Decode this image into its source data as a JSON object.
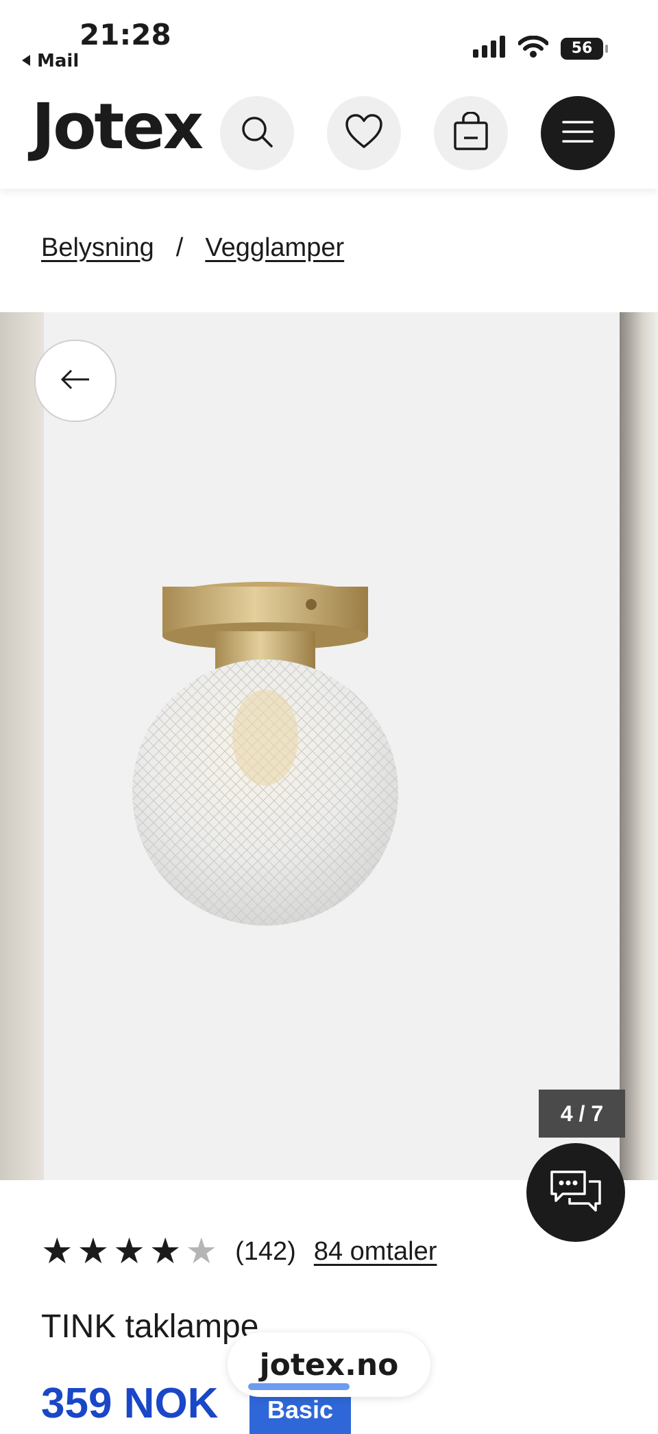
{
  "status_bar": {
    "time": "21:28",
    "back_label": "Mail",
    "battery": "56"
  },
  "header": {
    "logo": "Jotex",
    "icons": [
      "search-icon",
      "heart-icon",
      "bag-icon",
      "menu-icon"
    ]
  },
  "breadcrumb": {
    "items": [
      "Belysning",
      "Vegglamper"
    ],
    "separator": "/"
  },
  "gallery": {
    "counter": "4 / 7"
  },
  "product": {
    "rating_stars": 4,
    "rating_max": 5,
    "rating_count": "(142)",
    "reviews_link": "84 omtaler",
    "name": "TINK taklampe",
    "price": "359 NOK",
    "badge": "Basic"
  },
  "browser": {
    "url": "jotex.no"
  },
  "colors": {
    "price_blue": "#1a47c8",
    "badge_blue": "#2f67d8",
    "dark": "#1b1b1b"
  }
}
